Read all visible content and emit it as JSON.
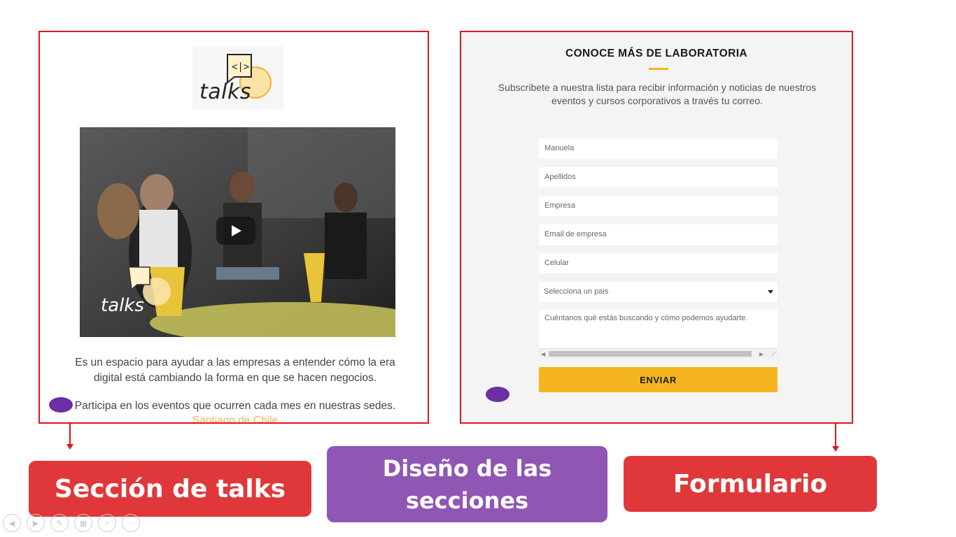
{
  "talks_section": {
    "logo_text": "talks",
    "logo_code": "<|>",
    "video_logo_text": "talks",
    "description": "Es un espacio para ayudar a las empresas a entender cómo la era digital está cambiando la forma en que se hacen negocios.",
    "events_text": "Participa en los eventos que ocurren cada mes en nuestras sedes.",
    "city_link": "Santiago de Chile"
  },
  "form": {
    "title": "CONOCE MÁS DE LABORATORIA",
    "subtitle": "Subscribete a nuestra lista para recibir información y noticias de nuestros eventos y cursos corporativos a través tu correo.",
    "fields": {
      "first_name": "Manuela",
      "last_name": "Apellidos",
      "company": "Empresa",
      "email": "Email de empresa",
      "phone": "Celular"
    },
    "country_select": "Selecciona un pais",
    "message_placeholder": "Cuéntanos qué estás buscando y cómo podemos ayudarte.",
    "submit_label": "ENVIAR"
  },
  "labels": {
    "talks": "Sección de talks",
    "design": "Diseño de las secciones",
    "form": "Formulario"
  },
  "colors": {
    "border": "#e0141b",
    "label_red": "#e0383a",
    "label_purple": "#8f56b4",
    "accent_yellow": "#f5b51f",
    "marker_purple": "#6b2fa3"
  },
  "toolbar": {
    "icons": [
      "prev-icon",
      "next-icon",
      "pen-icon",
      "slides-icon",
      "zoom-icon",
      "more-icon"
    ]
  }
}
